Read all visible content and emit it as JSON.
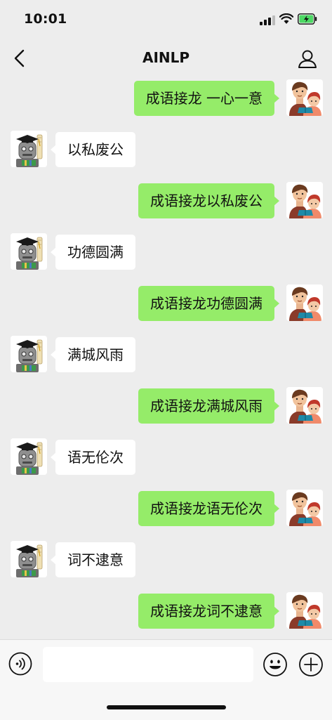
{
  "status_bar": {
    "time": "10:01"
  },
  "header": {
    "title": "AINLP"
  },
  "messages": [
    {
      "side": "out",
      "text": "成语接龙 一心一意"
    },
    {
      "side": "in",
      "text": "以私废公"
    },
    {
      "side": "out",
      "text": "成语接龙以私废公"
    },
    {
      "side": "in",
      "text": "功德圆满"
    },
    {
      "side": "out",
      "text": "成语接龙功德圆满"
    },
    {
      "side": "in",
      "text": "满城风雨"
    },
    {
      "side": "out",
      "text": "成语接龙满城风雨"
    },
    {
      "side": "in",
      "text": "语无伦次"
    },
    {
      "side": "out",
      "text": "成语接龙语无伦次"
    },
    {
      "side": "in",
      "text": "词不逮意"
    },
    {
      "side": "out",
      "text": "成语接龙词不逮意"
    }
  ],
  "input": {
    "value": ""
  },
  "colors": {
    "outgoing_bubble": "#95ec69",
    "incoming_bubble": "#ffffff",
    "background": "#ededed"
  }
}
